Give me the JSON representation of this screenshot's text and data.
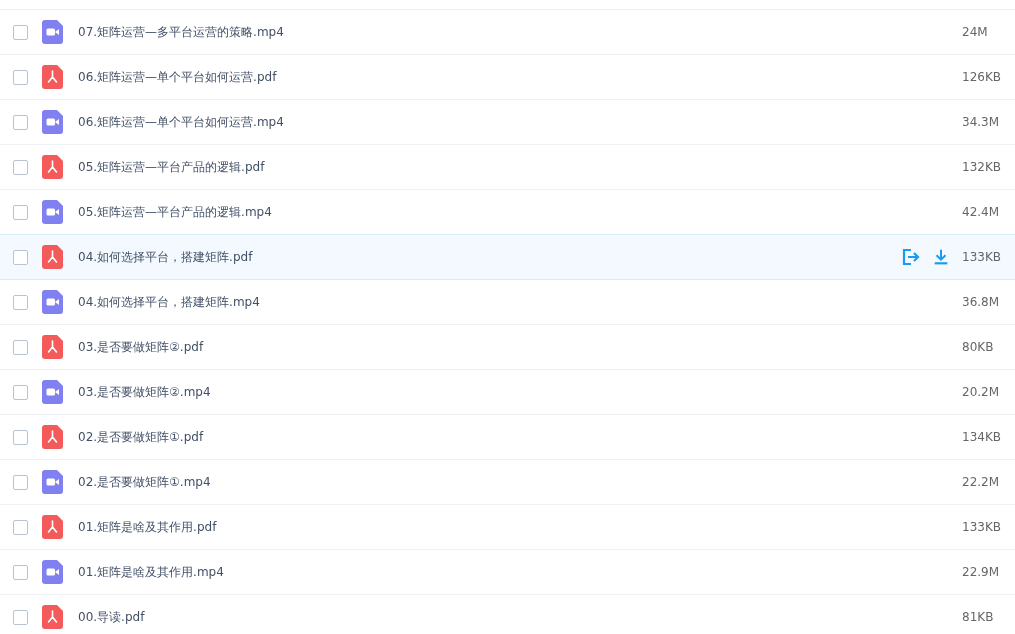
{
  "files": [
    {
      "kind": "video",
      "name": "07.矩阵运营—多平台运营的策略.mp4",
      "size": "24M",
      "checked": false,
      "hovered": false
    },
    {
      "kind": "pdf",
      "name": "06.矩阵运营—单个平台如何运营.pdf",
      "size": "126KB",
      "checked": false,
      "hovered": false
    },
    {
      "kind": "video",
      "name": "06.矩阵运营—单个平台如何运营.mp4",
      "size": "34.3M",
      "checked": false,
      "hovered": false
    },
    {
      "kind": "pdf",
      "name": "05.矩阵运营—平台产品的逻辑.pdf",
      "size": "132KB",
      "checked": false,
      "hovered": false
    },
    {
      "kind": "video",
      "name": "05.矩阵运营—平台产品的逻辑.mp4",
      "size": "42.4M",
      "checked": false,
      "hovered": false
    },
    {
      "kind": "pdf",
      "name": "04.如何选择平台，搭建矩阵.pdf",
      "size": "133KB",
      "checked": false,
      "hovered": true
    },
    {
      "kind": "video",
      "name": "04.如何选择平台，搭建矩阵.mp4",
      "size": "36.8M",
      "checked": false,
      "hovered": false
    },
    {
      "kind": "pdf",
      "name": "03.是否要做矩阵②.pdf",
      "size": "80KB",
      "checked": false,
      "hovered": false
    },
    {
      "kind": "video",
      "name": "03.是否要做矩阵②.mp4",
      "size": "20.2M",
      "checked": false,
      "hovered": false
    },
    {
      "kind": "pdf",
      "name": "02.是否要做矩阵①.pdf",
      "size": "134KB",
      "checked": false,
      "hovered": false
    },
    {
      "kind": "video",
      "name": "02.是否要做矩阵①.mp4",
      "size": "22.2M",
      "checked": false,
      "hovered": false
    },
    {
      "kind": "pdf",
      "name": "01.矩阵是啥及其作用.pdf",
      "size": "133KB",
      "checked": false,
      "hovered": false
    },
    {
      "kind": "video",
      "name": "01.矩阵是啥及其作用.mp4",
      "size": "22.9M",
      "checked": false,
      "hovered": false
    },
    {
      "kind": "pdf",
      "name": "00.导读.pdf",
      "size": "81KB",
      "checked": false,
      "hovered": false
    }
  ]
}
